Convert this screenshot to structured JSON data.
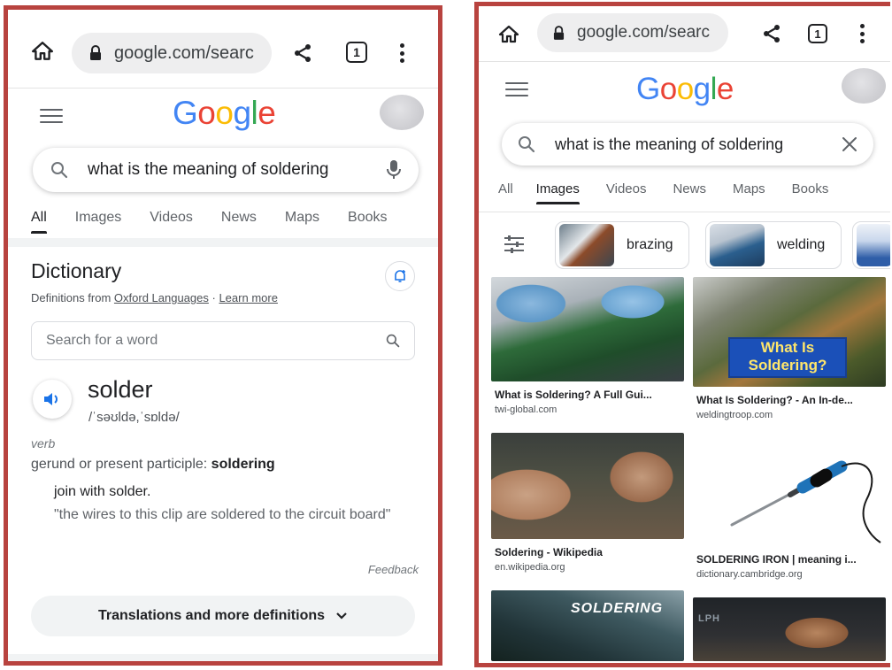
{
  "left_screen": {
    "browser": {
      "url": "google.com/searc",
      "tab_count": "1"
    },
    "header": {
      "logo": [
        "G",
        "o",
        "o",
        "g",
        "l",
        "e"
      ]
    },
    "search": {
      "query": "what is the meaning of soldering"
    },
    "tabs": [
      "All",
      "Images",
      "Videos",
      "News",
      "Maps",
      "Books"
    ],
    "active_tab": "All",
    "dictionary": {
      "title": "Dictionary",
      "source_prefix": "Definitions from ",
      "source_link": "Oxford Languages",
      "separator": " · ",
      "learn_more": "Learn more",
      "word_search_placeholder": "Search for a word",
      "word": "solder",
      "phonetic": "/ˈsəʊldə,ˈsɒldə/",
      "part_of_speech": "verb",
      "gerund_label": "gerund or present participle",
      "gerund_colon": ": ",
      "gerund_value": "soldering",
      "definition": "join with solder.",
      "example": "\"the wires to this clip are soldered to the circuit board\"",
      "feedback": "Feedback",
      "more_button": "Translations and more definitions"
    }
  },
  "right_screen": {
    "browser": {
      "url": "google.com/searc",
      "tab_count": "1"
    },
    "header": {
      "logo": [
        "G",
        "o",
        "o",
        "g",
        "l",
        "e"
      ]
    },
    "search": {
      "query": "what is the meaning of soldering"
    },
    "tabs": [
      "All",
      "Images",
      "Videos",
      "News",
      "Maps",
      "Books"
    ],
    "active_tab": "Images",
    "chips": [
      "brazing",
      "welding"
    ],
    "results": [
      {
        "caption": "What is Soldering? A Full Gui...",
        "source": "twi-global.com"
      },
      {
        "caption": "What Is Soldering? - An In-de...",
        "source": "weldingtroop.com",
        "overlay": [
          "What Is",
          "Soldering?"
        ]
      },
      {
        "caption": "Soldering - Wikipedia",
        "source": "en.wikipedia.org"
      },
      {
        "caption": "SOLDERING IRON | meaning i...",
        "source": "dictionary.cambridge.org"
      },
      {
        "overlay": "SOLDERING"
      },
      {
        "overlay": "LPH"
      }
    ]
  },
  "colors": {
    "frame": "#b8433f",
    "google_blue": "#4285f4",
    "google_red": "#ea4335",
    "google_yellow": "#fbbc05",
    "google_green": "#34a853"
  },
  "icons": [
    "home-icon",
    "lock-icon",
    "share-icon",
    "tab-switcher-icon",
    "more-vert-icon",
    "hamburger-icon",
    "search-icon",
    "mic-icon",
    "close-icon",
    "add-alert-icon",
    "speaker-icon",
    "chevron-down-icon",
    "filter-icon"
  ]
}
